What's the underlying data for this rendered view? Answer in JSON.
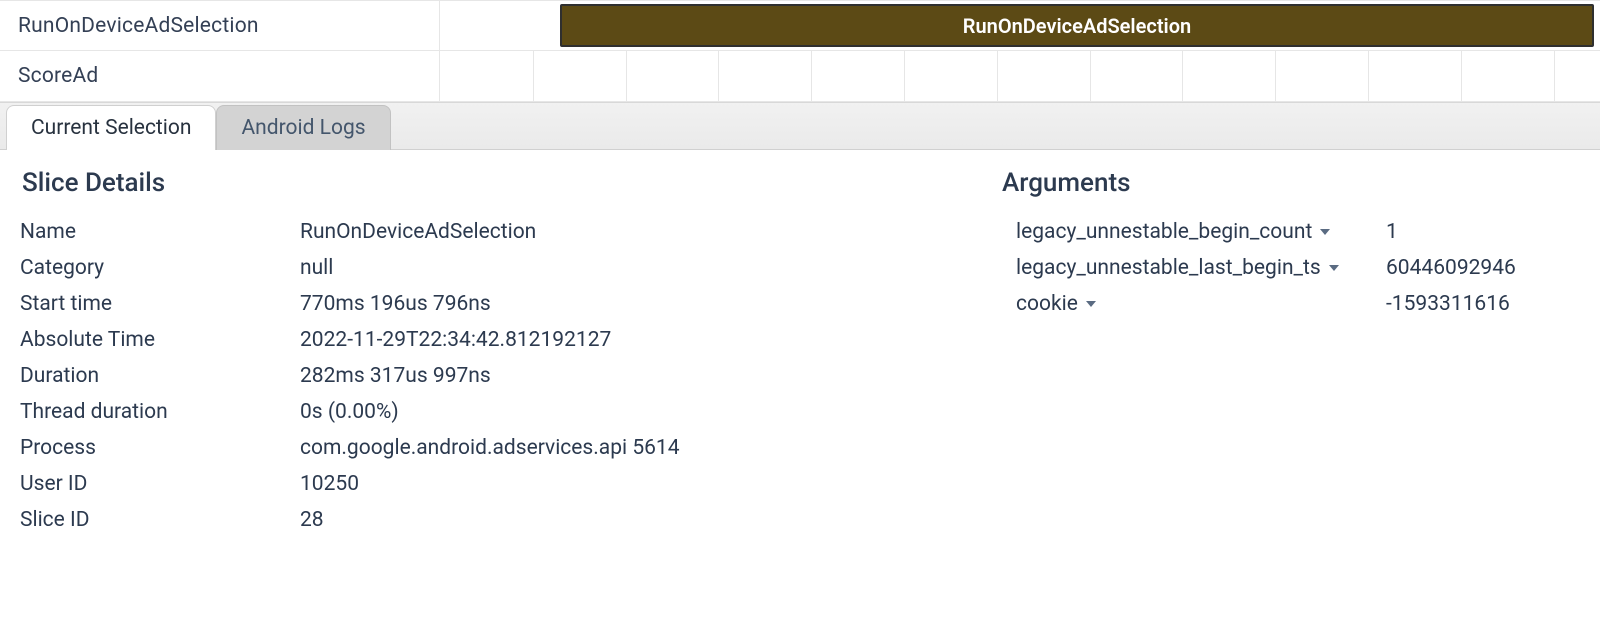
{
  "tracks": [
    {
      "label": "RunOnDeviceAdSelection",
      "slice_label": "RunOnDeviceAdSelection"
    },
    {
      "label": "ScoreAd"
    }
  ],
  "tabs": [
    {
      "label": "Current Selection",
      "active": true
    },
    {
      "label": "Android Logs",
      "active": false
    }
  ],
  "slice": {
    "section_title": "Slice Details",
    "rows": [
      {
        "label": "Name",
        "value": "RunOnDeviceAdSelection"
      },
      {
        "label": "Category",
        "value": "null"
      },
      {
        "label": "Start time",
        "value": "770ms 196us 796ns"
      },
      {
        "label": "Absolute Time",
        "value": "2022-11-29T22:34:42.812192127"
      },
      {
        "label": "Duration",
        "value": "282ms 317us 997ns"
      },
      {
        "label": "Thread duration",
        "value": "0s (0.00%)"
      },
      {
        "label": "Process",
        "value": "com.google.android.adservices.api 5614"
      },
      {
        "label": "User ID",
        "value": "10250"
      },
      {
        "label": "Slice ID",
        "value": "28"
      }
    ]
  },
  "args": {
    "section_title": "Arguments",
    "rows": [
      {
        "key": "legacy_unnestable_begin_count",
        "value": "1"
      },
      {
        "key": "legacy_unnestable_last_begin_ts",
        "value": "60446092946"
      },
      {
        "key": "cookie",
        "value": "-1593311616"
      }
    ]
  }
}
